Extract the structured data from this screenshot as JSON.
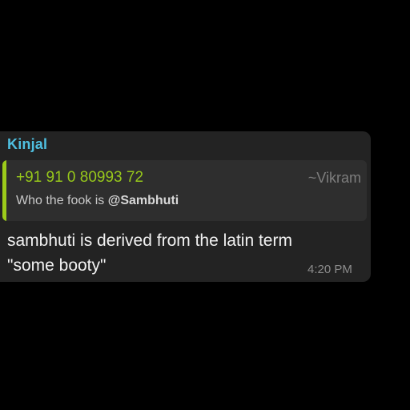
{
  "message": {
    "sender": "Kinjal",
    "reply": {
      "name": "+91 91 0 80993 72",
      "alias": "~Vikram",
      "text_prefix": "Who the fook is ",
      "mention": "@Sambhuti"
    },
    "text_line1": "sambhuti is derived from the latin term",
    "text_line2": "\"some booty\"",
    "time": "4:20 PM"
  },
  "colors": {
    "background": "#000000",
    "bubble": "#232323",
    "sender": "#4fbfe0",
    "reply_accent": "#9ccc1a",
    "reply_alias": "#7d7d7d"
  }
}
